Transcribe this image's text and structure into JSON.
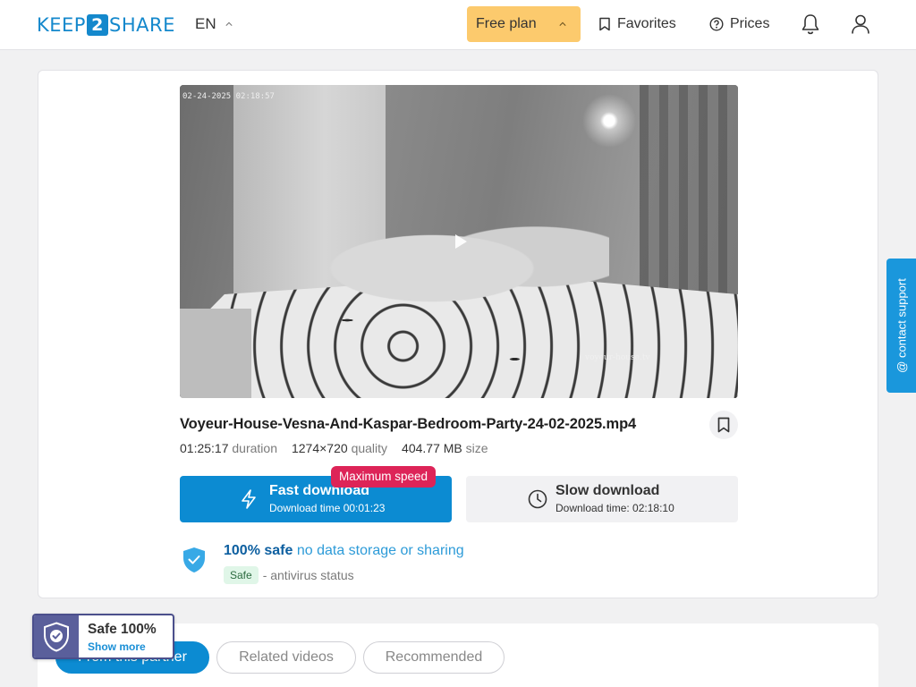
{
  "header": {
    "logo_left": "KEEP",
    "logo_num": "2",
    "logo_right": "SHARE",
    "lang": "EN",
    "plan_label": "Free plan",
    "favorites_label": "Favorites",
    "prices_label": "Prices"
  },
  "video": {
    "timestamp_overlay": "02-24-2025 02:18:57",
    "watermark": "voyeur-house.tv"
  },
  "file": {
    "name": "Voyeur-House-Vesna-And-Kaspar-Bedroom-Party-24-02-2025.mp4",
    "duration_value": "01:25:17",
    "duration_label": "duration",
    "quality_value": "1274×720",
    "quality_label": "quality",
    "size_value": "404.77 MB",
    "size_label": "size"
  },
  "downloads": {
    "fast_title": "Fast download",
    "fast_sub": "Download time 00:01:23",
    "max_speed_badge": "Maximum speed",
    "slow_title": "Slow download",
    "slow_sub": "Download time: 02:18:10"
  },
  "safety": {
    "headline_bold": "100% safe",
    "headline_rest": "no data storage or sharing",
    "status_badge": "Safe",
    "status_text": "- antivirus status"
  },
  "support_tab": "@ contact support",
  "tabs": [
    "From this partner",
    "Related videos",
    "Recommended"
  ],
  "safe_badge": {
    "title": "Safe 100%",
    "link": "Show more"
  },
  "colors": {
    "brand_blue": "#0c8bd2",
    "plan_yellow": "#fcca6d",
    "max_speed_red": "#dd2458",
    "safe_green_bg": "#e0f6e8"
  }
}
